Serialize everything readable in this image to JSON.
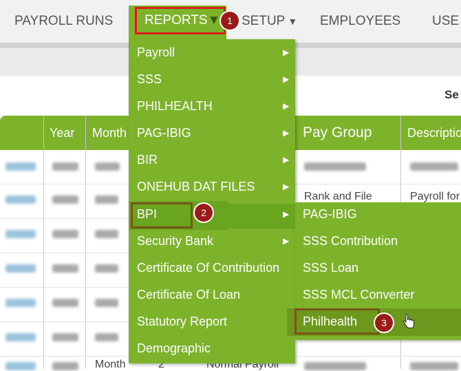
{
  "nav": {
    "payroll_runs": "PAYROLL RUNS",
    "reports": "REPORTS",
    "setup": "SETUP",
    "employees": "EMPLOYEES",
    "users": "USE",
    "dropdown_arrow": "▼"
  },
  "steps": {
    "one": "1",
    "two": "2",
    "three": "3"
  },
  "search_label": "Se",
  "table": {
    "headers": {
      "year": "Year",
      "month": "Month",
      "pay_group": "Pay Group",
      "description": "Descriptio"
    },
    "visible_cells": {
      "row2_pay_group": "Rank and File",
      "row2_description": "Payroll for",
      "last_row_month": "Month",
      "last_row_num": "2",
      "last_row_type": "Normal Payroll"
    }
  },
  "reports_menu": {
    "items": [
      {
        "label": "Payroll",
        "has_submenu": true
      },
      {
        "label": "SSS",
        "has_submenu": true
      },
      {
        "label": "PHILHEALTH",
        "has_submenu": true
      },
      {
        "label": "PAG-IBIG",
        "has_submenu": true
      },
      {
        "label": "BIR",
        "has_submenu": true
      },
      {
        "label": "ONEHUB DAT FILES",
        "has_submenu": true
      },
      {
        "label": "BPI",
        "has_submenu": true
      },
      {
        "label": "Security Bank",
        "has_submenu": true
      },
      {
        "label": "Certificate Of Contribution",
        "has_submenu": false
      },
      {
        "label": "Certificate Of Loan",
        "has_submenu": false
      },
      {
        "label": "Statutory Report",
        "has_submenu": false
      },
      {
        "label": "Demographic",
        "has_submenu": false
      }
    ],
    "chevron": "▶"
  },
  "bpi_submenu": {
    "items": [
      {
        "label": "PAG-IBIG"
      },
      {
        "label": "SSS Contribution"
      },
      {
        "label": "SSS Loan"
      },
      {
        "label": "SSS MCL Converter"
      },
      {
        "label": "Philhealth"
      }
    ]
  },
  "colors": {
    "menu_green": "#7cb32a",
    "highlight_red": "#d91c1c",
    "badge_red": "#9b1b1b"
  }
}
